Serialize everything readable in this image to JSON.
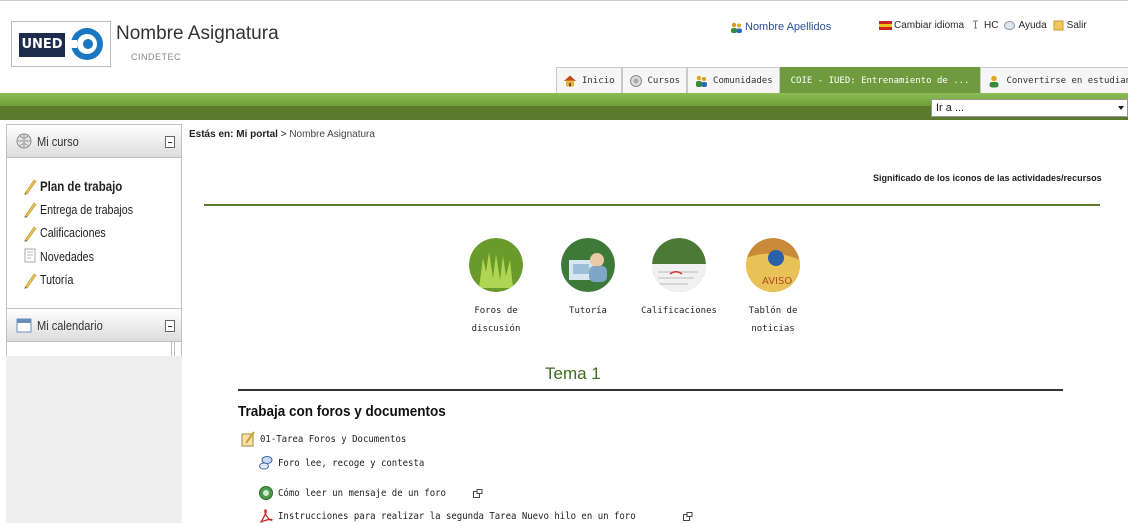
{
  "header": {
    "logo_text": "UNED",
    "course_title": "Nombre Asignatura",
    "course_subtitle": "CINDETEC",
    "user_name": "Nombre Apellidos",
    "links": [
      {
        "label": "Cambiar idioma",
        "icon": "flag-icon"
      },
      {
        "label": "HC",
        "icon": "pin-icon"
      },
      {
        "label": "Ayuda",
        "icon": "help-icon"
      },
      {
        "label": "Salir",
        "icon": "exit-icon"
      }
    ]
  },
  "tabs": [
    {
      "label": "Inicio",
      "icon": "home-icon"
    },
    {
      "label": "Cursos",
      "icon": "courses-icon"
    },
    {
      "label": "Comunidades",
      "icon": "communities-icon"
    },
    {
      "label": "COIE - IUED: Entrenamiento de ...",
      "icon": "",
      "active": true
    },
    {
      "label": "Convertirse en estudiante",
      "icon": "student-icon"
    }
  ],
  "goto": {
    "value": "Ir a ..."
  },
  "sidebar": {
    "mycourse_title": "Mi curso",
    "items": [
      {
        "label": "Plan de trabajo",
        "bold": true
      },
      {
        "label": "Entrega de trabajos"
      },
      {
        "label": "Calificaciones"
      },
      {
        "label": "Novedades"
      },
      {
        "label": "Tutoría"
      }
    ],
    "calendar_title": "Mi calendario"
  },
  "main": {
    "breadcrumb_prefix": "Estás en:",
    "breadcrumb_home": "Mi portal",
    "breadcrumb_sep": ">",
    "breadcrumb_current": "Nombre Asignatura",
    "icons_help": "Significado de los iconos de las actividades/recursos",
    "features": [
      {
        "line1": "Foros de",
        "line2": "discusión"
      },
      {
        "line1": "Tutoría",
        "line2": ""
      },
      {
        "line1": "Calificaciones",
        "line2": ""
      },
      {
        "line1": "Tablón de",
        "line2": "noticias"
      }
    ],
    "tema_title": "Tema 1",
    "section_heading": "Trabaja con foros y documentos",
    "activities": [
      {
        "label": "01-Tarea Foros y Documentos"
      },
      {
        "label": "Foro lee, recoge y contesta"
      },
      {
        "label": "Cómo leer un mensaje de un foro"
      },
      {
        "label": "Instrucciones para realizar la segunda Tarea Nuevo hilo en un foro"
      }
    ]
  },
  "colors": {
    "accent_green": "#6f9a3d",
    "dark_green": "#5b7a2b",
    "title_green": "#3f6a1f"
  }
}
